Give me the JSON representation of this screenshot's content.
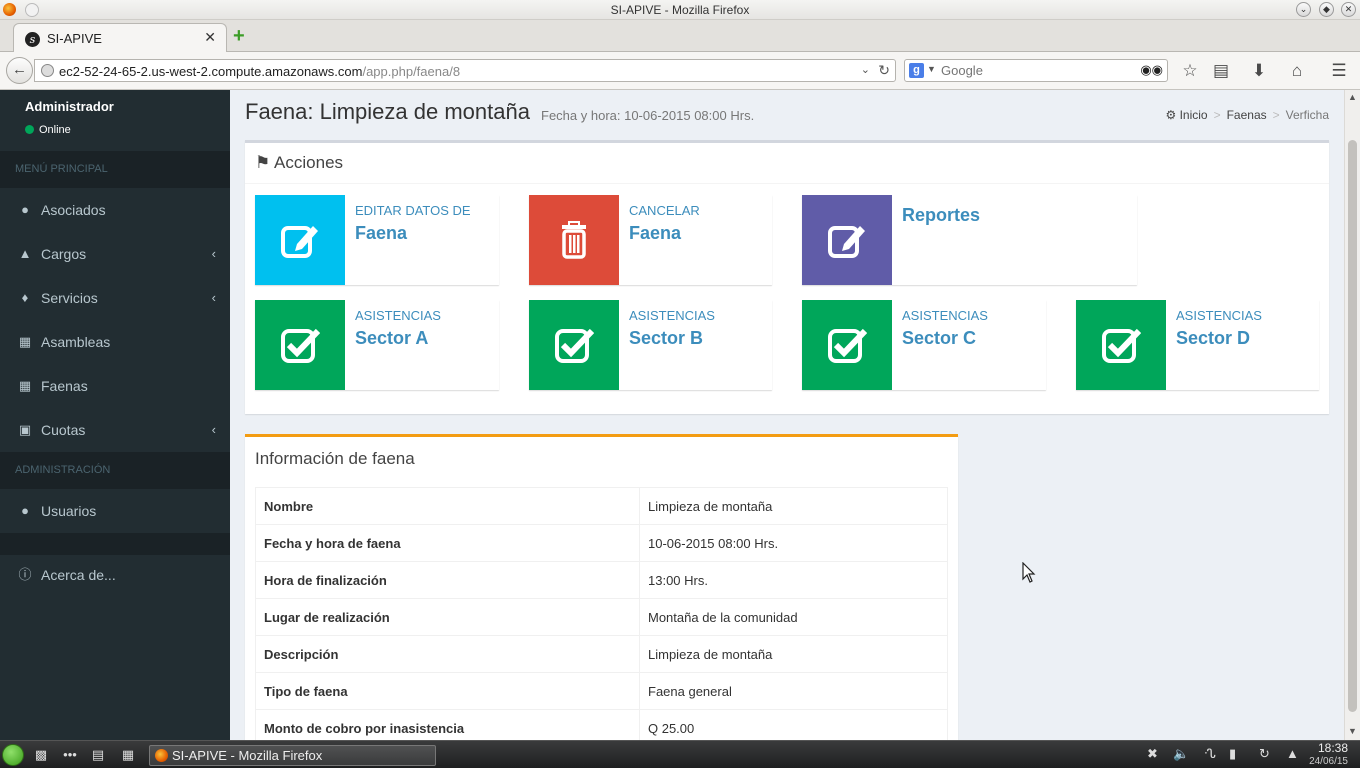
{
  "window": {
    "title": "SI-APIVE - Mozilla Firefox"
  },
  "browser": {
    "tab_label": "SI-APIVE",
    "url_host": "ec2-52-24-65-2.us-west-2.compute.amazonaws.com",
    "url_path": "/app.php/faena/8",
    "search_placeholder": "Google"
  },
  "sidebar": {
    "user_name": "Administrador",
    "user_status": "Online",
    "section_main": "MENÚ PRINCIPAL",
    "items_main": [
      {
        "label": "Asociados",
        "icon": "user-icon",
        "has_children": false
      },
      {
        "label": "Cargos",
        "icon": "sitemap-icon",
        "has_children": true
      },
      {
        "label": "Servicios",
        "icon": "tint-icon",
        "has_children": true
      },
      {
        "label": "Asambleas",
        "icon": "calendar-icon",
        "has_children": false
      },
      {
        "label": "Faenas",
        "icon": "calendar-icon",
        "has_children": false
      },
      {
        "label": "Cuotas",
        "icon": "money-icon",
        "has_children": true
      }
    ],
    "section_admin": "ADMINISTRACIÓN",
    "items_admin": [
      {
        "label": "Usuarios",
        "icon": "user-icon"
      }
    ],
    "about": {
      "label": "Acerca de...",
      "icon": "info-circle-icon"
    }
  },
  "page": {
    "title": "Faena: Limpieza de montaña",
    "subtitle": "Fecha y hora: 10-06-2015 08:00 Hrs.",
    "breadcrumb": [
      "Inicio",
      "Faenas",
      "Verficha"
    ]
  },
  "actions": {
    "title": "Acciones",
    "tiles": [
      {
        "text": "EDITAR DATOS DE",
        "number": "Faena",
        "icon": "edit-icon",
        "color": "#00c0ef"
      },
      {
        "text": "CANCELAR",
        "number": "Faena",
        "icon": "trash-icon",
        "color": "#dd4b39"
      },
      {
        "text": "",
        "number": "Reportes",
        "icon": "edit-icon",
        "color": "#605ca8"
      },
      {
        "text": "ASISTENCIAS",
        "number": "Sector A",
        "icon": "check-square-icon",
        "color": "#00a65a"
      },
      {
        "text": "ASISTENCIAS",
        "number": "Sector B",
        "icon": "check-square-icon",
        "color": "#00a65a"
      },
      {
        "text": "ASISTENCIAS",
        "number": "Sector C",
        "icon": "check-square-icon",
        "color": "#00a65a"
      },
      {
        "text": "ASISTENCIAS",
        "number": "Sector D",
        "icon": "check-square-icon",
        "color": "#00a65a"
      }
    ]
  },
  "info": {
    "title": "Información de faena",
    "rows": [
      {
        "key": "Nombre",
        "value": "Limpieza de montaña"
      },
      {
        "key": "Fecha y hora de faena",
        "value": "10-06-2015 08:00 Hrs."
      },
      {
        "key": "Hora de finalización",
        "value": "13:00 Hrs."
      },
      {
        "key": "Lugar de realización",
        "value": "Montaña de la comunidad"
      },
      {
        "key": "Descripción",
        "value": "Limpieza de montaña"
      },
      {
        "key": "Tipo de faena",
        "value": "Faena general"
      },
      {
        "key": "Monto de cobro por inasistencia",
        "value": "Q 25.00"
      }
    ]
  },
  "taskbar": {
    "task_label": "SI-APIVE - Mozilla Firefox",
    "time": "18:38",
    "date": "24/06/15"
  },
  "colors": {
    "sidebar_bg": "#222d32",
    "accent_link": "#3c8dbc",
    "aqua": "#00c0ef",
    "red": "#dd4b39",
    "purple": "#605ca8",
    "green": "#00a65a",
    "warning_border": "#f39c12"
  }
}
